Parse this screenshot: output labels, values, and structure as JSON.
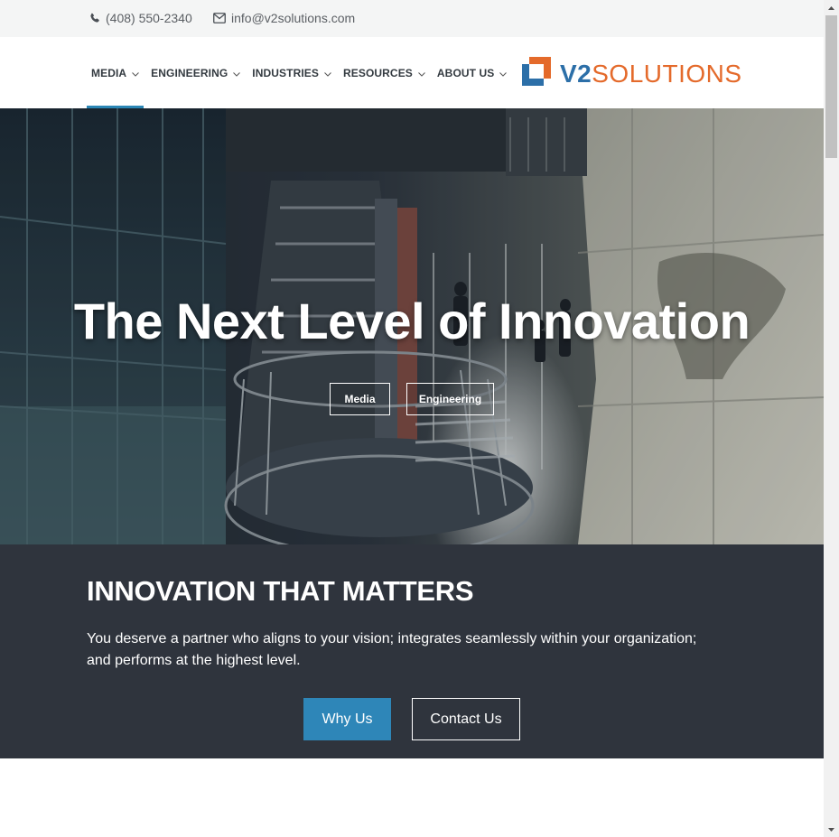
{
  "topbar": {
    "phone": "(408) 550-2340",
    "email": "info@v2solutions.com",
    "phone_icon": "phone-icon",
    "email_icon": "envelope-icon"
  },
  "nav": {
    "items": [
      {
        "label": "MEDIA",
        "active": true
      },
      {
        "label": "ENGINEERING",
        "active": false
      },
      {
        "label": "INDUSTRIES",
        "active": false
      },
      {
        "label": "RESOURCES",
        "active": false
      },
      {
        "label": "ABOUT US",
        "active": false
      }
    ],
    "chevron_icon": "chevron-down-icon"
  },
  "logo": {
    "brand_bold": "V2",
    "brand_light": "SOLUTIONS"
  },
  "hero": {
    "title": "The Next Level of Innovation",
    "buttons": [
      "Media",
      "Engineering"
    ]
  },
  "section": {
    "heading": "INNOVATION THAT MATTERS",
    "body": "You deserve a partner who aligns to your vision; integrates seamlessly within your organization; and performs at the highest level.",
    "primary_button": "Why Us",
    "secondary_button": "Contact Us"
  },
  "colors": {
    "accent": "#2b86b5",
    "logo_blue": "#2c6fa8",
    "logo_orange": "#e46a2b",
    "dark_section": "#2f343d",
    "topbar_bg": "#f4f5f5"
  }
}
